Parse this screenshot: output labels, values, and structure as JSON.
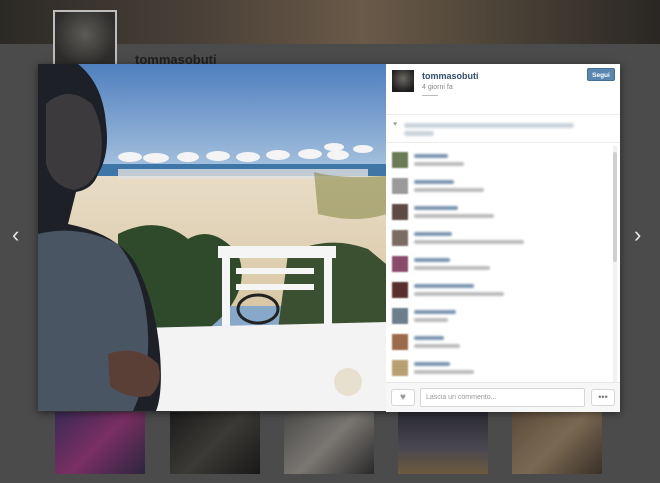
{
  "background_page": {
    "username": "tommasobuti"
  },
  "post": {
    "username": "tommasobuti",
    "time_ago": "4 giorni fa",
    "follow_label": "Segui"
  },
  "comment_form": {
    "placeholder": "Lascia un commento..."
  },
  "icons": {
    "prev": "chevron-left-icon",
    "next": "chevron-right-icon",
    "like": "heart-icon",
    "more": "ellipsis-icon"
  },
  "nav": {
    "prev_glyph": "‹",
    "next_glyph": "›"
  },
  "buttons": {
    "like_glyph": "♥",
    "more_glyph": "•••"
  },
  "colors": {
    "accent": "#5a87b0",
    "username": "#2f4f6f"
  }
}
